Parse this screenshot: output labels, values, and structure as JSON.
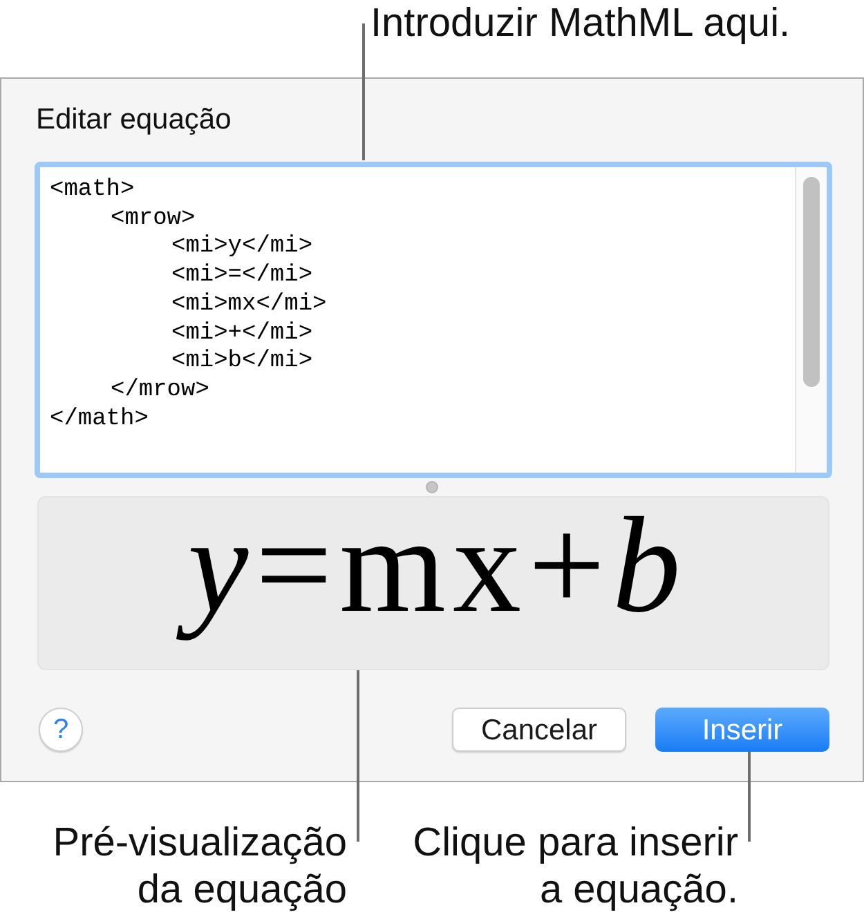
{
  "callout_top": {
    "text": "Introduzir MathML aqui."
  },
  "dialog": {
    "title": "Editar equação",
    "editor": {
      "value": "<math>\n\t<mrow>\n\t\t<mi>y</mi>\n\t\t<mi>=</mi>\n\t\t<mi>mx</mi>\n\t\t<mi>+</mi>\n\t\t<mi>b</mi>\n\t</mrow>\n</math>",
      "focused": true
    },
    "preview": {
      "equation": "*y*=mx+*b*"
    },
    "buttons": [
      {
        "label": "?",
        "kind": "help"
      },
      {
        "label": "Cancelar",
        "kind": "secondary"
      },
      {
        "label": "Inserir",
        "kind": "primary"
      }
    ]
  },
  "callouts_bottom": [
    {
      "text": "Pré-visualização da equação"
    },
    {
      "text": "Clique para inserir a equação."
    }
  ]
}
